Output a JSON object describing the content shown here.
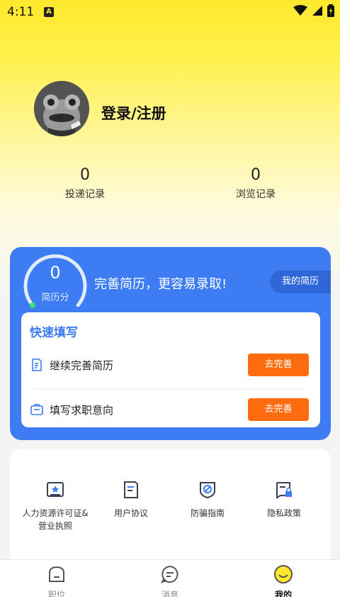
{
  "status_bar": {
    "time": "4:11",
    "notification_badge": "A",
    "icons": [
      "wifi-icon",
      "signal-icon",
      "battery-icon"
    ]
  },
  "profile": {
    "login_label": "登录/注册",
    "stats": [
      {
        "value": "0",
        "label": "投递记录"
      },
      {
        "value": "0",
        "label": "浏览记录"
      }
    ]
  },
  "resume": {
    "score": "0",
    "score_label": "简历分",
    "slogan": "完善简历，更容易录取!",
    "my_resume_button": "我的简历",
    "quick_fill": {
      "title": "快速填写",
      "items": [
        {
          "label": "继续完善简历",
          "button": "去完善",
          "icon": "edit-document-icon"
        },
        {
          "label": "填写求职意向",
          "button": "去完善",
          "icon": "briefcase-icon"
        }
      ]
    }
  },
  "services": [
    {
      "label": "人力资源许可证&营业执照",
      "icon": "license-icon"
    },
    {
      "label": "用户协议",
      "icon": "document-icon"
    },
    {
      "label": "防骗指南",
      "icon": "shield-icon"
    },
    {
      "label": "隐私政策",
      "icon": "privacy-icon"
    }
  ],
  "bottom_nav": [
    {
      "label": "职位",
      "icon": "home-icon",
      "active": false
    },
    {
      "label": "消息",
      "icon": "message-icon",
      "active": false
    },
    {
      "label": "我的",
      "icon": "profile-icon",
      "active": true
    }
  ],
  "colors": {
    "accent_yellow": "#ffe92d",
    "primary_blue": "#3d7cf2",
    "action_orange": "#ff6c10"
  }
}
